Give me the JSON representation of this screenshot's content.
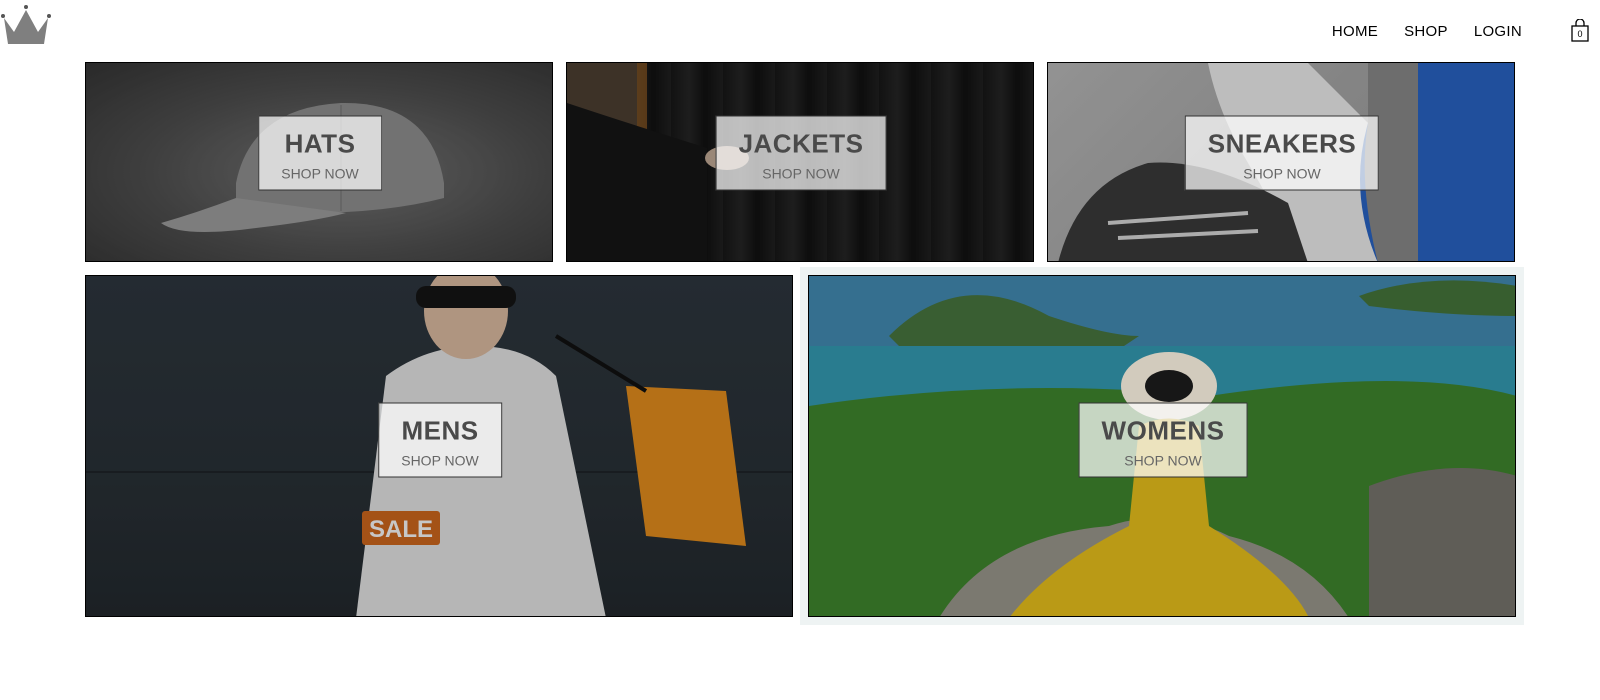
{
  "header": {
    "logo_icon": "crown-icon",
    "nav": [
      {
        "label": "HOME"
      },
      {
        "label": "SHOP"
      },
      {
        "label": "LOGIN"
      }
    ],
    "cart": {
      "icon": "shopping-bag-icon",
      "count": "0"
    }
  },
  "categories": {
    "hats": {
      "title": "HATS",
      "cta": "SHOP NOW"
    },
    "jackets": {
      "title": "JACKETS",
      "cta": "SHOP NOW"
    },
    "sneakers": {
      "title": "SNEAKERS",
      "cta": "SHOP NOW"
    },
    "mens": {
      "title": "MENS",
      "cta": "SHOP NOW",
      "photo_text": "SALE"
    },
    "womens": {
      "title": "WOMENS",
      "cta": "SHOP NOW"
    }
  },
  "colors": {
    "logo": "#808080",
    "sale_tag": "#d2691e",
    "shopping_bag": "#e8901e",
    "dress": "#d4b01a",
    "sneaker_blue": "#2a66c8"
  }
}
